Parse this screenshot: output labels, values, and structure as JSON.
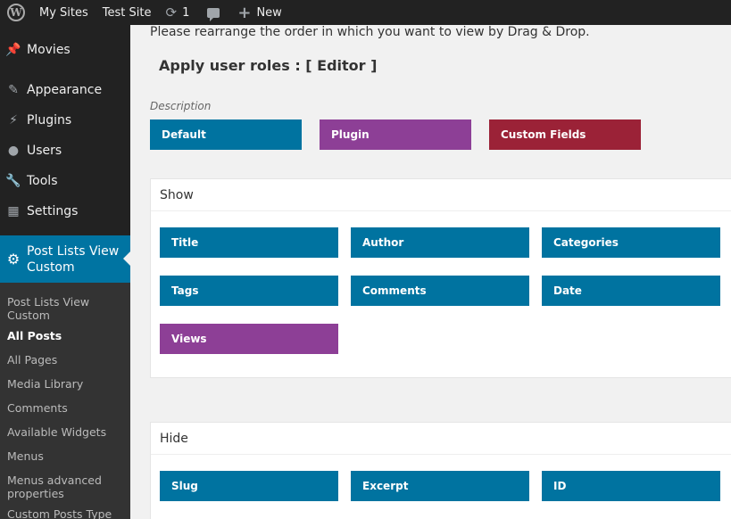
{
  "adminbar": {
    "my_sites": "My Sites",
    "site_name": "Test Site",
    "updates_count": "1",
    "new_label": "New"
  },
  "sidebar": {
    "items": [
      {
        "label": "Movies",
        "icon": "pin-icon"
      },
      {
        "label": "Appearance",
        "icon": "brush-icon"
      },
      {
        "label": "Plugins",
        "icon": "plugin-icon"
      },
      {
        "label": "Users",
        "icon": "user-icon"
      },
      {
        "label": "Tools",
        "icon": "wrench-icon"
      },
      {
        "label": "Settings",
        "icon": "settings-icon"
      }
    ],
    "current": {
      "label_line1": "Post Lists View",
      "label_line2": "Custom",
      "icon": "gear-icon"
    },
    "submenu": [
      {
        "label": "Post Lists View Custom"
      },
      {
        "label": "All Posts"
      },
      {
        "label": "All Pages"
      },
      {
        "label": "Media Library"
      },
      {
        "label": "Comments"
      },
      {
        "label": "Available Widgets"
      },
      {
        "label": "Menus"
      },
      {
        "label": "Menus advanced properties"
      },
      {
        "label": "Custom Posts Type"
      }
    ]
  },
  "main": {
    "intro": "Please rearrange the order in which you want to view by Drag & Drop.",
    "roles_title": "Apply user roles : [ Editor ]",
    "description_label": "Description",
    "legend": {
      "default": "Default",
      "plugin": "Plugin",
      "custom_fields": "Custom Fields"
    },
    "show_panel": {
      "title": "Show",
      "items": [
        "Title",
        "Author",
        "Categories",
        "Tags",
        "Comments",
        "Date",
        "Views"
      ]
    },
    "hide_panel": {
      "title": "Hide",
      "items": [
        "Slug",
        "Excerpt",
        "ID"
      ]
    }
  },
  "colors": {
    "default": "#0073a0",
    "plugin": "#8d3f96",
    "custom_fields": "#9b2237",
    "menu_current": "#0074a2"
  }
}
